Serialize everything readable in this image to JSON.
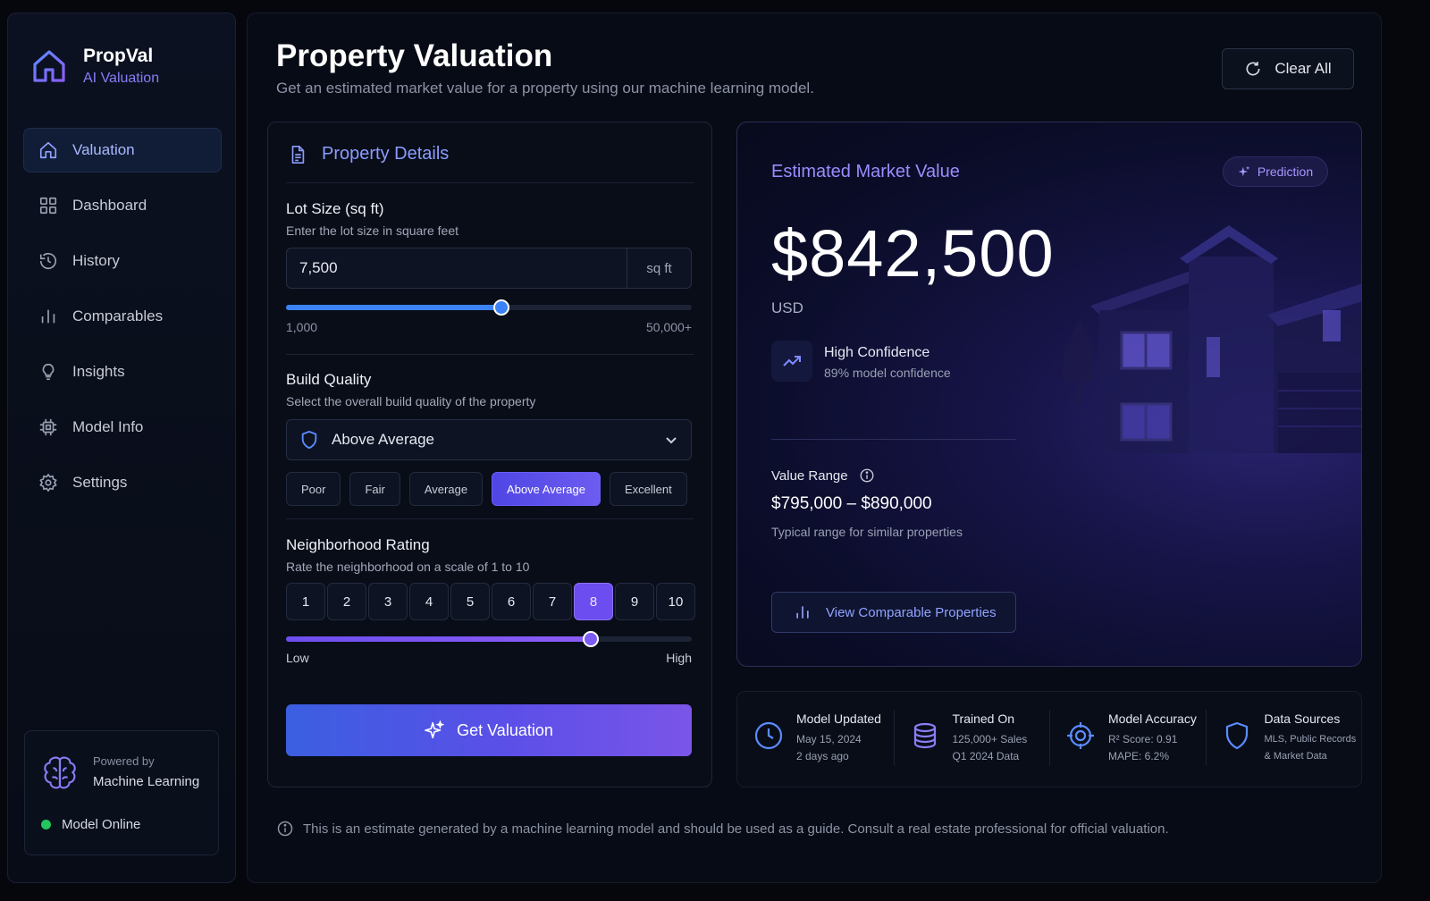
{
  "brand": {
    "name": "PropVal",
    "subtitle": "AI Valuation"
  },
  "sidebar": {
    "items": [
      {
        "label": "Valuation",
        "icon": "home-icon",
        "active": true
      },
      {
        "label": "Dashboard",
        "icon": "grid-icon"
      },
      {
        "label": "History",
        "icon": "history-icon"
      },
      {
        "label": "Comparables",
        "icon": "bar-chart-icon"
      },
      {
        "label": "Insights",
        "icon": "lightbulb-icon"
      },
      {
        "label": "Model Info",
        "icon": "chip-icon"
      },
      {
        "label": "Settings",
        "icon": "gear-icon"
      }
    ],
    "powered": {
      "small": "Powered by",
      "big": "Machine Learning",
      "status": "Model Online",
      "status_color": "#22c55e"
    }
  },
  "header": {
    "title": "Property Valuation",
    "subtitle": "Get an estimated market value for a property using our machine learning model.",
    "clear_label": "Clear All"
  },
  "details": {
    "title": "Property Details",
    "lot": {
      "label": "Lot Size (sq ft)",
      "help": "Enter the lot size in square feet",
      "value": "7,500",
      "unit": "sq ft",
      "min_label": "1,000",
      "max_label": "50,000+",
      "slider_fraction": 0.53
    },
    "quality": {
      "label": "Build Quality",
      "help": "Select the overall build quality of the property",
      "selected": "Above Average",
      "options": [
        "Poor",
        "Fair",
        "Average",
        "Above Average",
        "Excellent"
      ]
    },
    "neighborhood": {
      "label": "Neighborhood Rating",
      "help": "Rate the neighborhood on a scale of 1 to 10",
      "options": [
        "1",
        "2",
        "3",
        "4",
        "5",
        "6",
        "7",
        "8",
        "9",
        "10"
      ],
      "selected": "8",
      "min_label": "Low",
      "max_label": "High",
      "slider_fraction": 0.75
    },
    "submit_label": "Get Valuation"
  },
  "estimate": {
    "title": "Estimated Market Value",
    "badge": "Prediction",
    "price": "$842,500",
    "currency": "USD",
    "confidence_title": "High Confidence",
    "confidence_sub": "89% model confidence",
    "range_label": "Value Range",
    "range_value": "$795,000 – $890,000",
    "range_sub": "Typical range for similar properties",
    "comparables_label": "View Comparable Properties"
  },
  "stats": [
    {
      "icon": "clock-icon",
      "title": "Model Updated",
      "line1": "May 15, 2024",
      "line2": "2 days ago"
    },
    {
      "icon": "database-icon",
      "title": "Trained On",
      "line1": "125,000+ Sales",
      "line2": "Q1 2024 Data"
    },
    {
      "icon": "target-icon",
      "title": "Model Accuracy",
      "line1": "R² Score: 0.91",
      "line2": "MAPE: 6.2%"
    },
    {
      "icon": "shield-icon",
      "title": "Data Sources",
      "line1": "MLS, Public Records",
      "line2": "& Market Data"
    }
  ],
  "disclaimer": "This is an estimate generated by a machine learning model and should be used as a guide. Consult a real estate professional for official valuation.",
  "colors": {
    "accent": "#6c4df0",
    "accent_blue": "#3b82f6",
    "brand_purple": "#8b7cf6"
  }
}
